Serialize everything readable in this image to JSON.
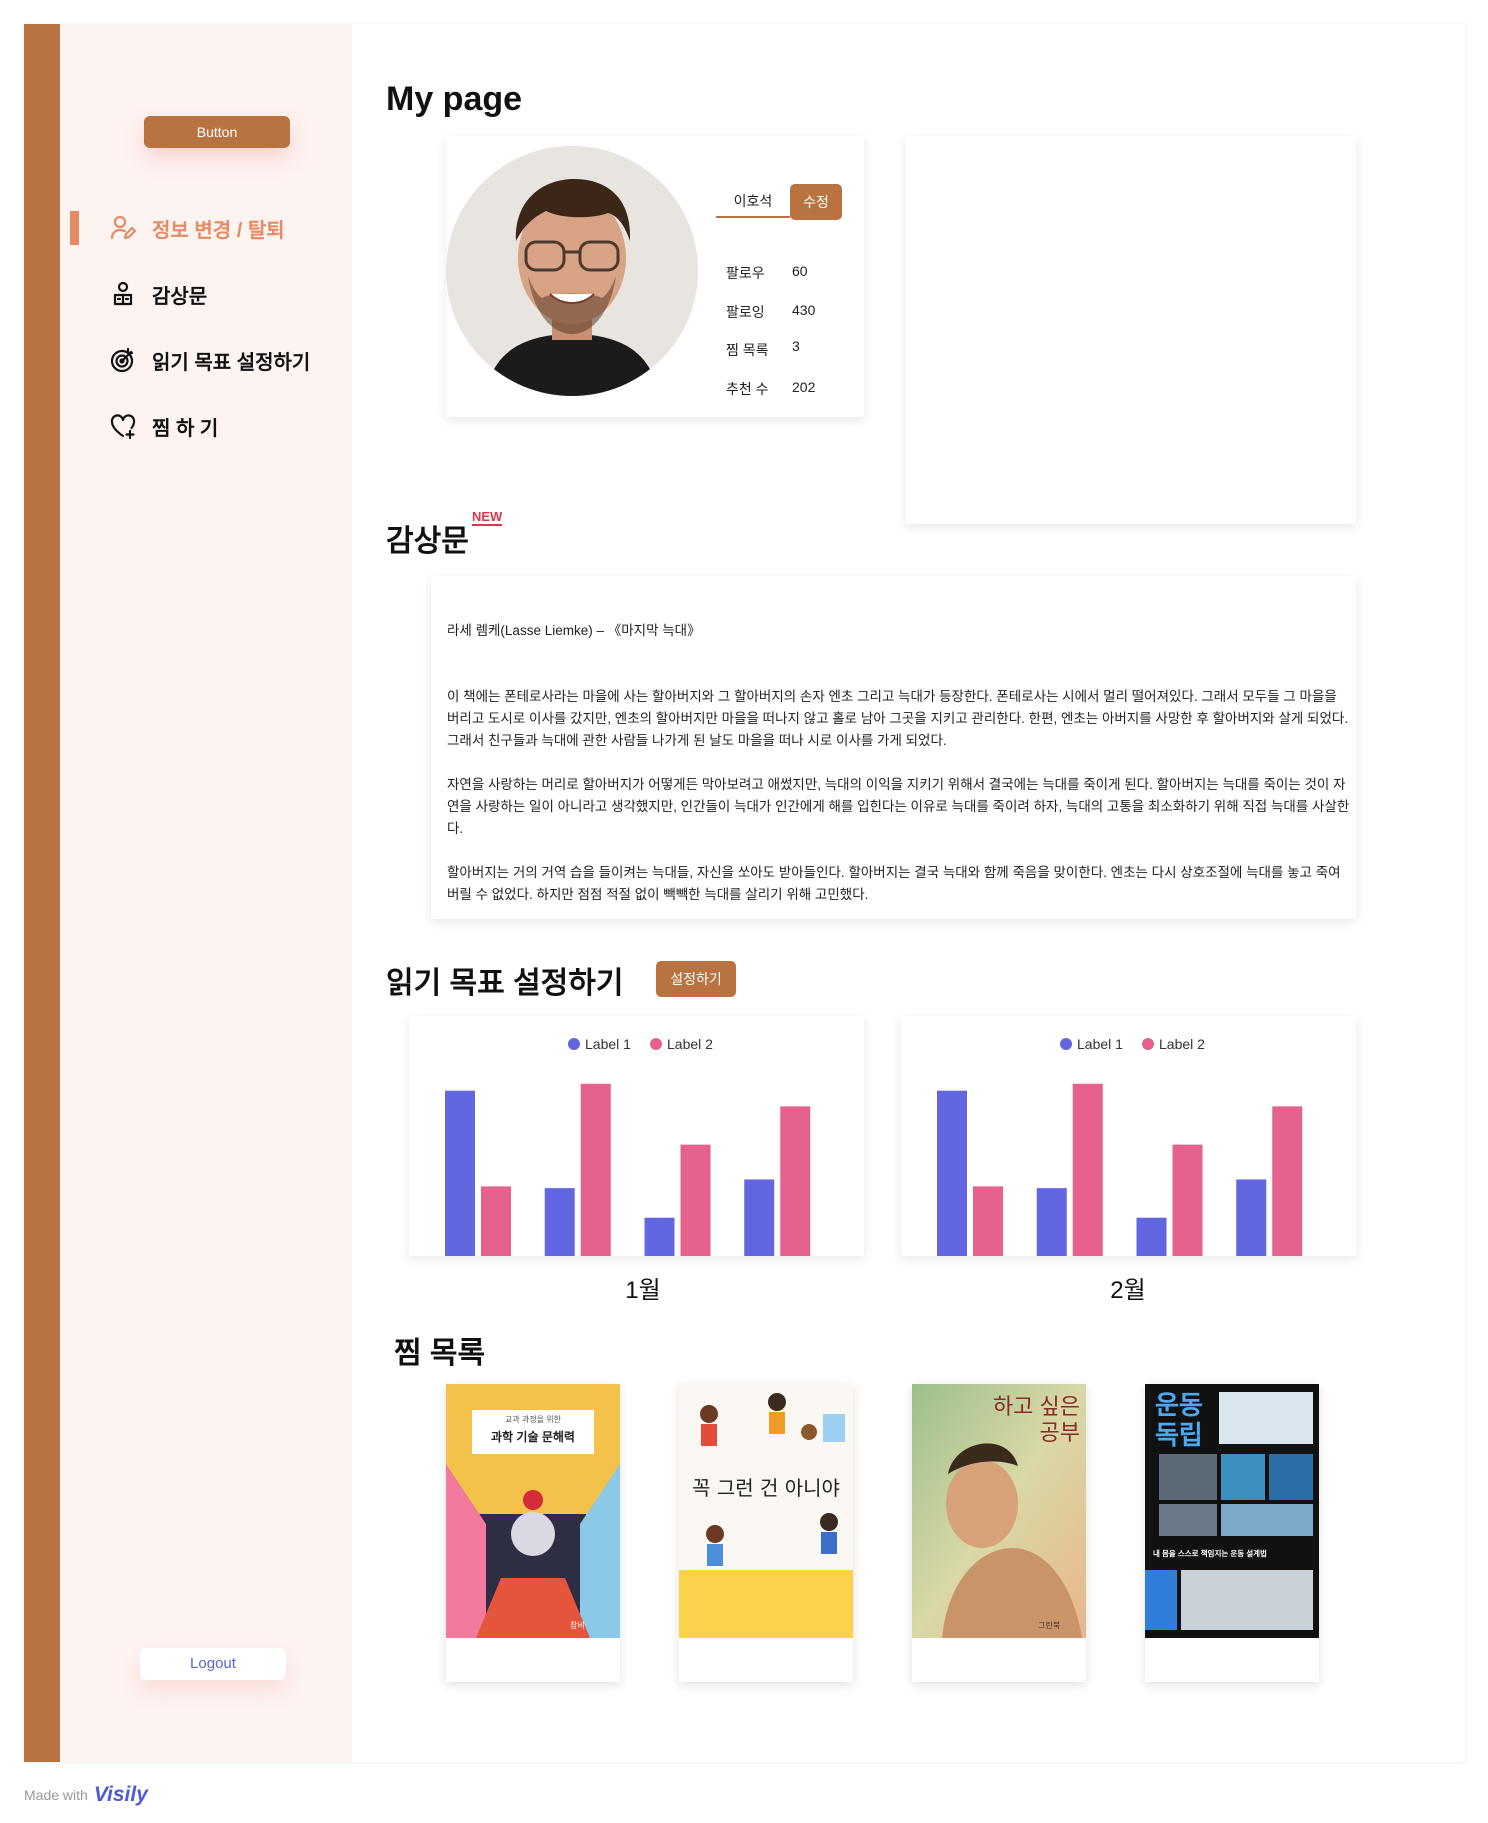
{
  "sidebar": {
    "top_button": "Button",
    "items": [
      {
        "label": "정보 변경 / 탈퇴",
        "icon": "user-edit-icon"
      },
      {
        "label": "감상문",
        "icon": "reader-icon"
      },
      {
        "label": "읽기 목표 설정하기",
        "icon": "target-icon"
      },
      {
        "label": "찜 하 기",
        "icon": "heart-plus-icon"
      }
    ],
    "logout": "Logout"
  },
  "page_title": "My page",
  "profile": {
    "name": "이호석",
    "edit_label": "수정",
    "stats": [
      {
        "label": "팔로우",
        "value": "60"
      },
      {
        "label": "팔로잉",
        "value": "430"
      },
      {
        "label": "찜 목록",
        "value": "3"
      },
      {
        "label": "추천 수",
        "value": "202"
      }
    ]
  },
  "review": {
    "title": "감상문",
    "badge": "NEW",
    "book_line": "라세 렘케(Lasse Liemke) – 《마지막 늑대》",
    "paragraphs": [
      "이 책에는 폰테로사라는 마을에 사는 할아버지와 그 할아버지의 손자 엔초 그리고 늑대가 등장한다. 폰테로사는 시에서 멀리 떨어져있다. 그래서 모두들 그 마을을 버리고 도시로 이사를 갔지만, 엔초의 할아버지만 마을을 떠나지 않고 홀로 남아 그곳을 지키고 관리한다. 한편, 엔초는 아버지를 사망한 후 할아버지와 살게 되었다. 그래서 친구들과 늑대에 관한 사람들 나가게 된 날도 마을을 떠나 시로 이사를 가게 되었다.",
      "자연을 사랑하는 머리로 할아버지가 어떻게든 막아보려고 애썼지만, 늑대의 이익을 지키기 위해서 결국에는 늑대를 죽이게 된다. 할아버지는 늑대를 죽이는 것이 자연을 사랑하는 일이 아니라고 생각했지만, 인간들이 늑대가 인간에게 해를 입힌다는 이유로 늑대를 죽이려 하자, 늑대의 고통을 최소화하기 위해 직접 늑대를 사살한다.",
      "할아버지는 거의 거역 습을 들이켜는 늑대들, 자신을 쏘아도 받아들인다. 할아버지는 결국 늑대와 함께 죽음을 맞이한다. 엔초는 다시 상호조절에 늑대를 놓고 죽여버릴 수 없었다. 하지만 점점 적절 없이 빽빽한 늑대를 살리기 위해 고민했다."
    ]
  },
  "goal": {
    "title": "읽기 목표 설정하기",
    "button": "설정하기"
  },
  "chart_data": [
    {
      "type": "bar",
      "caption": "1월",
      "categories": [
        "",
        "",
        "",
        ""
      ],
      "series": [
        {
          "name": "Label 1",
          "color": "#6366e1",
          "values": [
            95,
            39,
            22,
            44
          ]
        },
        {
          "name": "Label 2",
          "color": "#e5618e",
          "values": [
            40,
            99,
            64,
            86
          ]
        }
      ],
      "ylim": [
        0,
        100
      ],
      "legend": "top-center",
      "grid": false
    },
    {
      "type": "bar",
      "caption": "2월",
      "categories": [
        "",
        "",
        "",
        ""
      ],
      "series": [
        {
          "name": "Label 1",
          "color": "#6366e1",
          "values": [
            95,
            39,
            22,
            44
          ]
        },
        {
          "name": "Label 2",
          "color": "#e5618e",
          "values": [
            40,
            99,
            64,
            86
          ]
        }
      ],
      "ylim": [
        0,
        100
      ],
      "legend": "top-center",
      "grid": false
    }
  ],
  "wishlist": {
    "title": "찜 목록",
    "books": [
      {
        "cover_text": "과학 기술 문해력",
        "cover_top": "교과 과정을 위한",
        "publisher": "창비"
      },
      {
        "cover_text": "꼭 그런 건 아니야",
        "cover_top": "",
        "publisher": ""
      },
      {
        "cover_text": "하고 싶은 공부",
        "cover_top": "",
        "publisher": "그린북"
      },
      {
        "cover_text": "운동 독립",
        "cover_top": "",
        "publisher": "",
        "subtitle": "내 몸을 스스로 책임지는 운동 설계법"
      }
    ]
  },
  "footer": {
    "made_with": "Made with",
    "logo": "Visily"
  }
}
